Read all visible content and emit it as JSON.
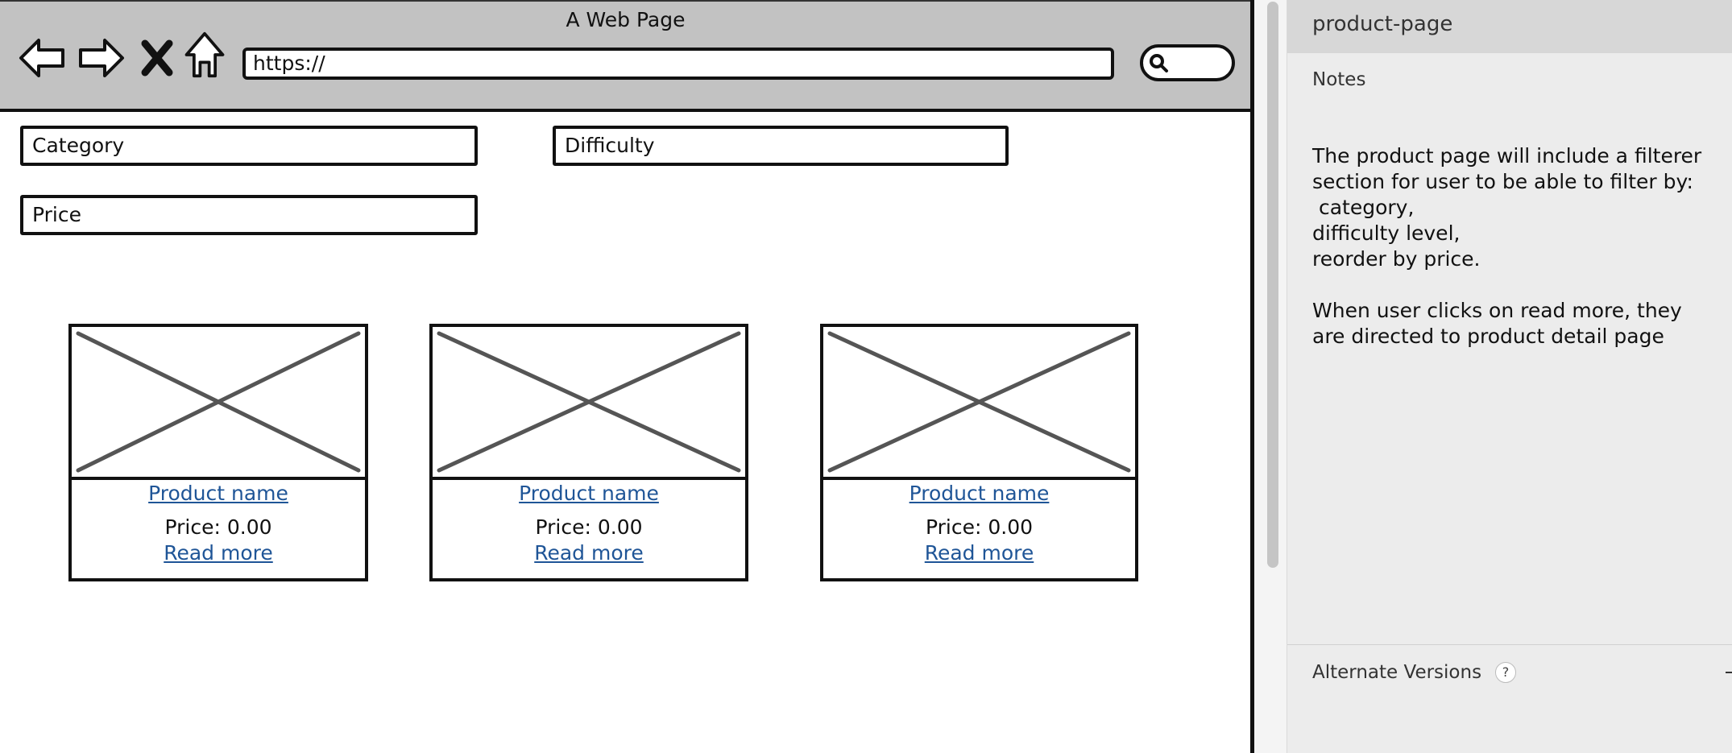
{
  "browser": {
    "window_title": "A Web Page",
    "url": "https://",
    "icons": [
      "back-arrow-icon",
      "forward-arrow-icon",
      "close-x-icon",
      "home-icon",
      "search-icon"
    ]
  },
  "filters": {
    "category": "Category",
    "difficulty": "Difficulty",
    "price": "Price"
  },
  "products": [
    {
      "name": "Product name",
      "price": "Price: 0.00",
      "read_more": "Read more"
    },
    {
      "name": "Product name",
      "price": "Price: 0.00",
      "read_more": "Read more"
    },
    {
      "name": "Product name",
      "price": "Price: 0.00",
      "read_more": "Read more"
    }
  ],
  "panel": {
    "title": "product-page",
    "notes_label": "Notes",
    "notes_text": "The product page will include a filterer section for user to be able to filter by:\n category,\ndifficulty level,\nreorder by price.\n\nWhen user clicks on read more, they are directed to product detail page",
    "alternate_versions_label": "Alternate Versions",
    "help_symbol": "?"
  },
  "colors": {
    "browser_bar": "#c2c2c2",
    "link": "#1f5597",
    "panel_bg": "#ececec",
    "panel_header": "#d7d7d7"
  }
}
